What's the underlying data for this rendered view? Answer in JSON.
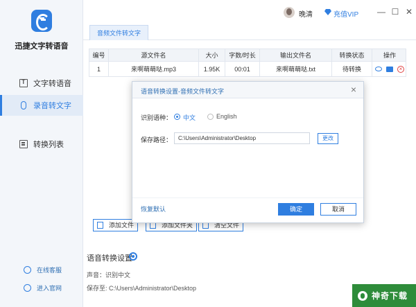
{
  "app": {
    "name": "迅捷文字转语音"
  },
  "sidebar": {
    "items": [
      {
        "label": "文字转语音",
        "icon": "text-icon"
      },
      {
        "label": "录音转文字",
        "icon": "microphone-icon",
        "active": true
      },
      {
        "label": "转换列表",
        "icon": "list-icon"
      }
    ],
    "links": [
      {
        "label": "在线客服",
        "icon": "headset-icon"
      },
      {
        "label": "进入官网",
        "icon": "globe-icon"
      }
    ]
  },
  "titlebar": {
    "username": "晚清",
    "vip_label": "充值VIP",
    "min": "—",
    "max": "☐",
    "close": "✕"
  },
  "tabs": [
    {
      "label": "音频文件转文字",
      "active": true
    }
  ],
  "table": {
    "headers": [
      "编号",
      "源文件名",
      "大小",
      "字数/时长",
      "输出文件名",
      "转换状态",
      "操作"
    ],
    "rows": [
      {
        "index": "1",
        "source": "来啊萌萌哒.mp3",
        "size": "1.95K",
        "duration": "00:01",
        "output": "来啊萌萌哒.txt",
        "status": "待转换"
      }
    ]
  },
  "bottom_buttons": {
    "add_file": "添加文件",
    "add_folder": "添加文件夹",
    "clear_files": "清空文件"
  },
  "settings": {
    "title": "语音转换设置",
    "voice_line": "声音：识别中文",
    "save_line": "保存至: C:\\Users\\Administrator\\Desktop"
  },
  "dialog": {
    "title": "语音转换设置-音频文件转文字",
    "lang_label": "识别语种：",
    "lang_options": [
      "中文",
      "English"
    ],
    "lang_selected": "中文",
    "path_label": "保存路径：",
    "path_value": "C:\\Users\\Administrator\\Desktop",
    "change_label": "更改",
    "restore_label": "恢复默认",
    "ok_label": "确定",
    "cancel_label": "取消"
  },
  "watermark": {
    "text": "神奇下载"
  },
  "colors": {
    "accent": "#2f7ee0",
    "danger": "#e04343",
    "watermark": "#2e8c3a"
  }
}
